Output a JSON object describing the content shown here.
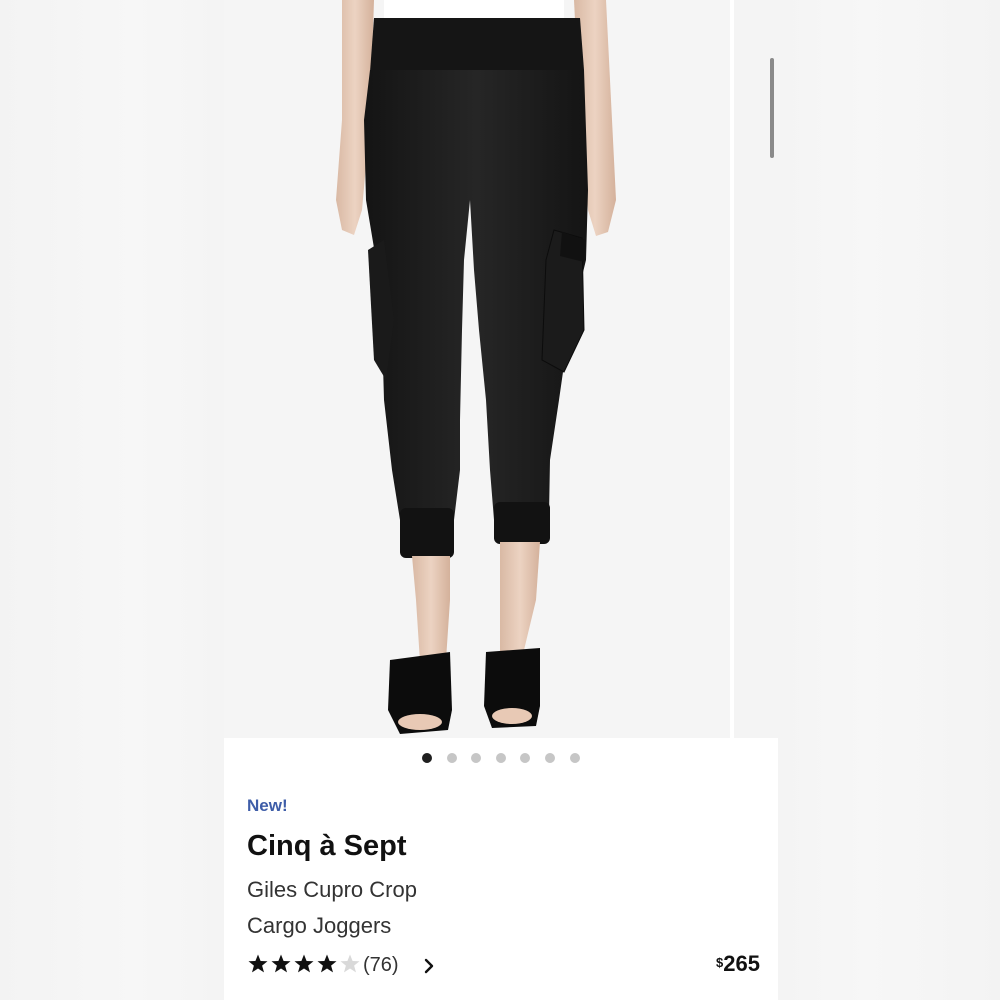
{
  "carousel": {
    "dot_count": 7,
    "active_index": 0
  },
  "product": {
    "badge": "New!",
    "brand": "Cinq à Sept",
    "name_line1": "Giles Cupro Crop",
    "name_line2": "Cargo Joggers",
    "rating": 4,
    "rating_max": 5,
    "review_count": "(76)",
    "price_currency": "$",
    "price_amount": "265"
  },
  "icons": {
    "star_filled": "star-filled-icon",
    "star_empty": "star-empty-icon",
    "chevron": "chevron-right-icon"
  },
  "colors": {
    "badge": "#3e5da8",
    "text_primary": "#111111",
    "star_filled": "#111111",
    "star_empty": "#d9d9d9",
    "dot_active": "#1f1f1f",
    "dot_inactive": "#c6c6c6"
  }
}
